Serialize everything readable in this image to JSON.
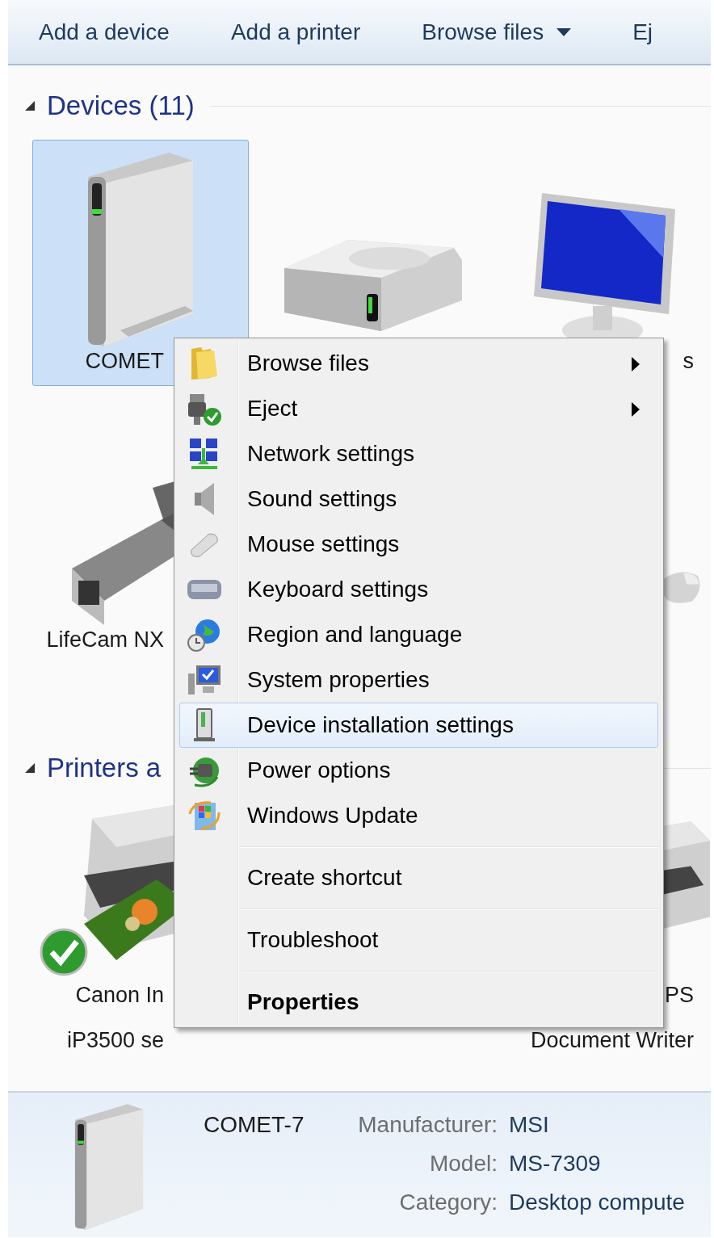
{
  "toolbar": {
    "items": [
      {
        "label": "Add a device",
        "dropdown": false
      },
      {
        "label": "Add a printer",
        "dropdown": false
      },
      {
        "label": "Browse files",
        "dropdown": true
      },
      {
        "label": "Ej",
        "dropdown": false
      }
    ]
  },
  "sections": [
    {
      "title": "Devices (11)",
      "expanded": true,
      "rows": [
        [
          {
            "kind": "computer",
            "label": [
              "COMET"
            ],
            "selected": true
          },
          {
            "kind": "drive",
            "selected": false
          },
          {
            "kind": "monitor",
            "label": [
              "s"
            ],
            "selected": false
          }
        ],
        [
          {
            "kind": "webcam",
            "label": [
              "LifeCam NX"
            ],
            "selected": false
          },
          {
            "kind": "mouse",
            "selected": false
          }
        ]
      ]
    },
    {
      "title": "Printers a",
      "expanded": true,
      "rows": [
        [
          {
            "kind": "printer",
            "label": [
              "Canon In",
              "iP3500 se"
            ],
            "selected": false,
            "default": true
          },
          {
            "kind": "printer",
            "label": [
              "PS",
              "Document Writer"
            ],
            "selected": false,
            "default": false
          }
        ]
      ]
    }
  ],
  "context_menu": {
    "items": [
      {
        "kind": "command",
        "label": "Browse files",
        "submenu": true,
        "selected": false,
        "default": false
      },
      {
        "kind": "command",
        "label": "Eject",
        "submenu": true,
        "selected": false,
        "default": false
      },
      {
        "kind": "command",
        "label": "Network settings",
        "submenu": false,
        "selected": false,
        "default": false
      },
      {
        "kind": "command",
        "label": "Sound settings",
        "submenu": false,
        "selected": false,
        "default": false
      },
      {
        "kind": "command",
        "label": "Mouse settings",
        "submenu": false,
        "selected": false,
        "default": false
      },
      {
        "kind": "command",
        "label": "Keyboard settings",
        "submenu": false,
        "selected": false,
        "default": false
      },
      {
        "kind": "command",
        "label": "Region and language",
        "submenu": false,
        "selected": false,
        "default": false
      },
      {
        "kind": "command",
        "label": "System properties",
        "submenu": false,
        "selected": false,
        "default": false
      },
      {
        "kind": "command",
        "label": "Device installation settings",
        "submenu": false,
        "selected": true,
        "default": false
      },
      {
        "kind": "command",
        "label": "Power options",
        "submenu": false,
        "selected": false,
        "default": false
      },
      {
        "kind": "command",
        "label": "Windows Update",
        "submenu": false,
        "selected": false,
        "default": false
      },
      {
        "kind": "separator"
      },
      {
        "kind": "command",
        "label": "Create shortcut",
        "submenu": false,
        "selected": false,
        "default": false
      },
      {
        "kind": "separator"
      },
      {
        "kind": "command",
        "label": "Troubleshoot",
        "submenu": false,
        "selected": false,
        "default": false
      },
      {
        "kind": "separator"
      },
      {
        "kind": "command",
        "label": "Properties",
        "submenu": false,
        "selected": false,
        "default": true
      }
    ]
  },
  "details": {
    "name": "COMET-7",
    "fields": [
      {
        "label": "Manufacturer:",
        "value": "MSI"
      },
      {
        "label": "Model:",
        "value": "MS-7309"
      },
      {
        "label": "Category:",
        "value": "Desktop compute"
      }
    ]
  }
}
